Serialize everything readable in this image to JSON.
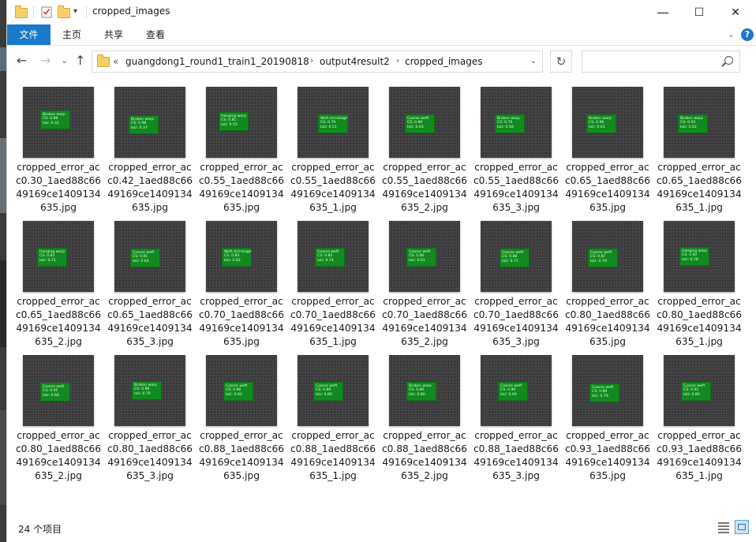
{
  "window": {
    "title": "cropped_images",
    "controls": {
      "minimize": "—",
      "maximize": "☐",
      "close": "✕"
    }
  },
  "ribbon": {
    "tabs": [
      "文件",
      "主页",
      "共享",
      "查看"
    ],
    "help": "?",
    "colors": {
      "file_tab": "#1979ca"
    }
  },
  "nav": {
    "back": "←",
    "forward": "→",
    "history": "⌄",
    "up": "↑",
    "path_prefix": "«",
    "breadcrumbs": [
      "guangdong1_round1_train1_20190818",
      "output4result2",
      "cropped_images"
    ],
    "crumb_separator": "›",
    "address_dropdown": "⌄",
    "refresh": "↻",
    "search_placeholder": ""
  },
  "files": [
    {
      "name": "cropped_error_acc0.30_1aed88c6649169ce1409134635.jpg",
      "det": [
        "Broken warp",
        "CS: 0.88",
        "IoU: 0.32"
      ]
    },
    {
      "name": "cropped_error_acc0.42_1aed88c6649169ce1409134635.jpg",
      "det": [
        "Broken warp",
        "CS: 0.98",
        "IoU: 0.37"
      ]
    },
    {
      "name": "cropped_error_acc0.55_1aed88c6649169ce1409134635.jpg",
      "det": [
        "Hanging warp",
        "CS: 0.81",
        "IoU: 0.55"
      ]
    },
    {
      "name": "cropped_error_acc0.55_1aed88c6649169ce1409134635_1.jpg",
      "det": [
        "Weft shrinkage",
        "CS: 0.79",
        "IoU: 0.51"
      ]
    },
    {
      "name": "cropped_error_acc0.55_1aed88c6649169ce1409134635_2.jpg",
      "det": [
        "Coarse weft",
        "CS: 0.80",
        "IoU: 0.63"
      ]
    },
    {
      "name": "cropped_error_acc0.55_1aed88c6649169ce1409134635_3.jpg",
      "det": [
        "Broken warp",
        "CS: 0.76",
        "IoU: 0.58"
      ]
    },
    {
      "name": "cropped_error_acc0.65_1aed88c6649169ce1409134635.jpg",
      "det": [
        "Broken warp",
        "CS: 0.96",
        "IoU: 0.61"
      ]
    },
    {
      "name": "cropped_error_acc0.65_1aed88c6649169ce1409134635_1.jpg",
      "det": [
        "Broken warp",
        "CS: 0.93",
        "IoU: 0.62"
      ]
    },
    {
      "name": "cropped_error_acc0.65_1aed88c6649169ce1409134635_2.jpg",
      "det": [
        "Hanging warp",
        "CS: 0.83",
        "IoU: 0.71"
      ]
    },
    {
      "name": "cropped_error_acc0.65_1aed88c6649169ce1409134635_3.jpg",
      "det": [
        "Coarse weft",
        "CS: 0.81",
        "IoU: 0.64"
      ]
    },
    {
      "name": "cropped_error_acc0.70_1aed88c6649169ce1409134635.jpg",
      "det": [
        "Weft shrinkage",
        "CS: 0.83",
        "IoU: 0.82"
      ]
    },
    {
      "name": "cropped_error_acc0.70_1aed88c6649169ce1409134635_1.jpg",
      "det": [
        "Coarse weft",
        "CS: 0.85",
        "IoU: 0.74"
      ]
    },
    {
      "name": "cropped_error_acc0.70_1aed88c6649169ce1409134635_2.jpg",
      "det": [
        "Coarse weft",
        "CS: 0.86",
        "IoU: 0.61"
      ]
    },
    {
      "name": "cropped_error_acc0.70_1aed88c6649169ce1409134635_3.jpg",
      "det": [
        "Coarse weft",
        "CS: 0.88",
        "IoU: 0.71"
      ]
    },
    {
      "name": "cropped_error_acc0.80_1aed88c6649169ce1409134635.jpg",
      "det": [
        "Coarse weft",
        "CS: 0.87",
        "IoU: 0.79"
      ]
    },
    {
      "name": "cropped_error_acc0.80_1aed88c6649169ce1409134635_1.jpg",
      "det": [
        "Hanging warp",
        "CS: 0.92",
        "IoU: 0.78"
      ]
    },
    {
      "name": "cropped_error_acc0.80_1aed88c6649169ce1409134635_2.jpg",
      "det": [
        "Coarse weft",
        "CS: 0.95",
        "IoU: 0.68"
      ]
    },
    {
      "name": "cropped_error_acc0.80_1aed88c6649169ce1409134635_3.jpg",
      "det": [
        "Broken warp",
        "CS: 0.96",
        "IoU: 0.79"
      ]
    },
    {
      "name": "cropped_error_acc0.88_1aed88c6649169ce1409134635.jpg",
      "det": [
        "Coarse weft",
        "CS: 0.86",
        "IoU: 0.83"
      ]
    },
    {
      "name": "cropped_error_acc0.88_1aed88c6649169ce1409134635_1.jpg",
      "det": [
        "Coarse weft",
        "CS: 0.89",
        "IoU: 0.80"
      ]
    },
    {
      "name": "cropped_error_acc0.88_1aed88c6649169ce1409134635_2.jpg",
      "det": [
        "Broken warp",
        "CS: 0.86",
        "IoU: 0.80"
      ]
    },
    {
      "name": "cropped_error_acc0.88_1aed88c6649169ce1409134635_3.jpg",
      "det": [
        "Coarse weft",
        "CS: 0.90",
        "IoU: 0.90"
      ]
    },
    {
      "name": "cropped_error_acc0.93_1aed88c6649169ce1409134635.jpg",
      "det": [
        "Coarse weft",
        "CS: 0.89",
        "IoU: 0.79"
      ]
    },
    {
      "name": "cropped_error_acc0.93_1aed88c6649169ce1409134635_1.jpg",
      "det": [
        "Coarse weft",
        "CS: 0.91",
        "IoU: 0.86"
      ]
    }
  ],
  "status": {
    "count_text": "24 个项目"
  }
}
